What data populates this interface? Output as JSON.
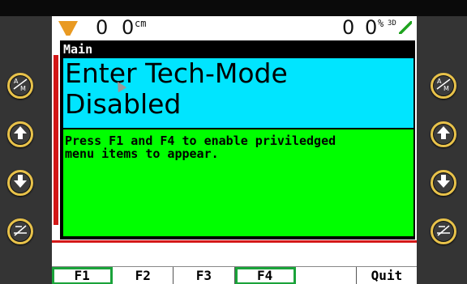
{
  "status": {
    "zero_left": "0",
    "unit_left": "cm",
    "zero_right": "0",
    "unit_right": "%",
    "unit_right_sup": "3D"
  },
  "dialog": {
    "title": "Main",
    "heading": "Enter Tech-Mode\nDisabled",
    "message": "Press F1 and F4 to enable priviledged\nmenu items to appear."
  },
  "function_keys": [
    {
      "label": "F1",
      "highlighted": true
    },
    {
      "label": "F2",
      "highlighted": false
    },
    {
      "label": "F3",
      "highlighted": false
    },
    {
      "label": "F4",
      "highlighted": true
    },
    {
      "label": "",
      "highlighted": false
    },
    {
      "label": "Quit",
      "highlighted": false
    }
  ],
  "side_buttons": {
    "left": [
      "auto-manual-icon",
      "arrow-up-icon",
      "arrow-down-icon",
      "tilt-icon"
    ],
    "right": [
      "auto-manual-icon",
      "arrow-up-icon",
      "arrow-down-icon",
      "tilt-icon"
    ]
  },
  "colors": {
    "button_ring": "#e8c24a",
    "title_bar": "#000000",
    "heading_bg": "#00e5ff",
    "body_bg": "#00ff00",
    "highlight": "#1aa33a"
  }
}
